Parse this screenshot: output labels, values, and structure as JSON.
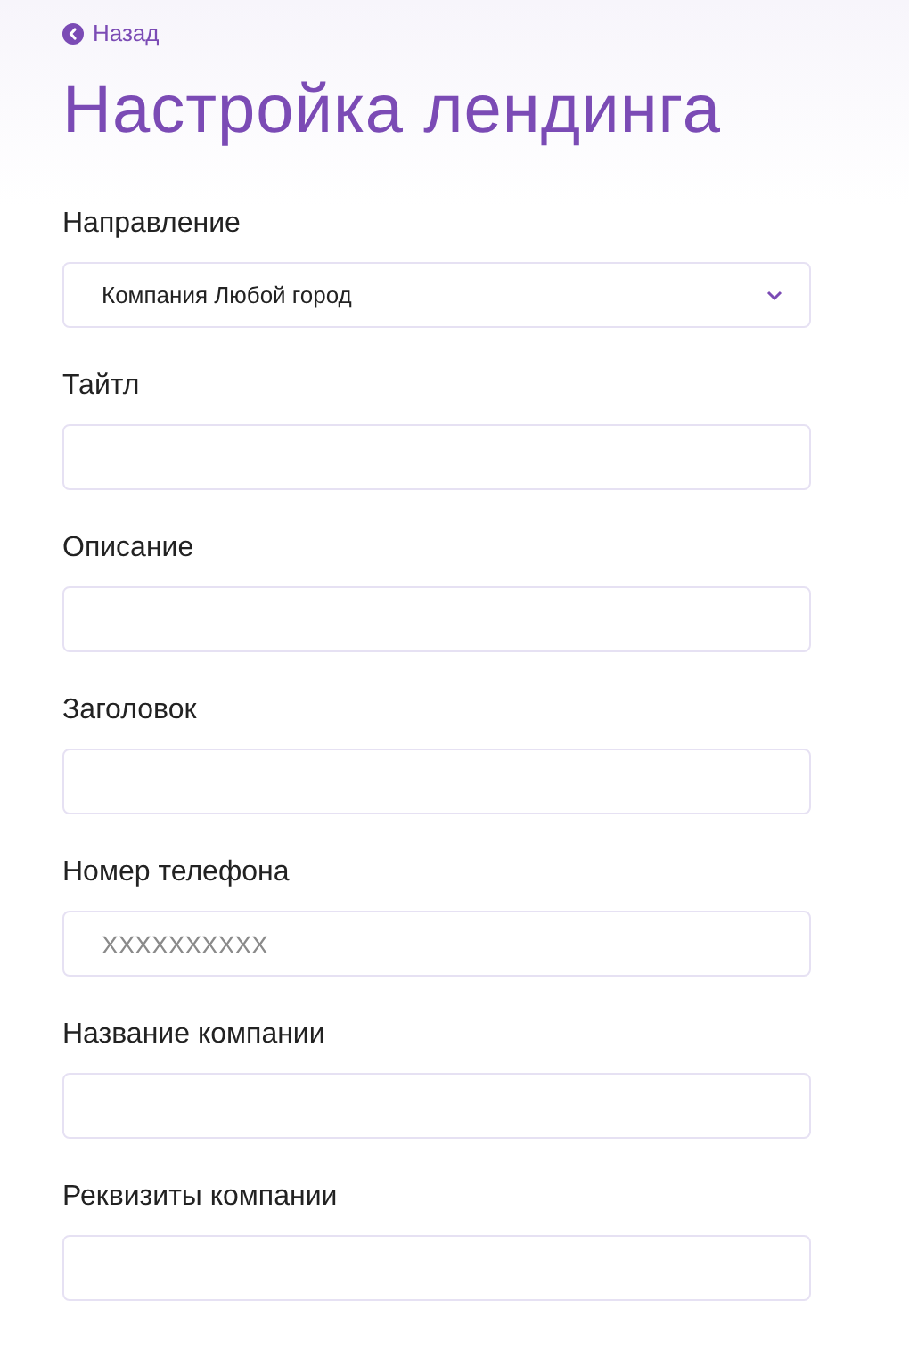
{
  "back_link": "Назад",
  "title": "Настройка лендинга",
  "fields": [
    {
      "kind": "select",
      "label": "Направление",
      "value": "Компания Любой город"
    },
    {
      "kind": "text",
      "label": "Тайтл"
    },
    {
      "kind": "text",
      "label": "Описание"
    },
    {
      "kind": "text",
      "label": "Заголовок"
    },
    {
      "kind": "text",
      "label": "Номер телефона",
      "placeholder": "XXXXXXXXXX"
    },
    {
      "kind": "text",
      "label": "Название компании"
    },
    {
      "kind": "text",
      "label": "Реквизиты компании"
    }
  ]
}
